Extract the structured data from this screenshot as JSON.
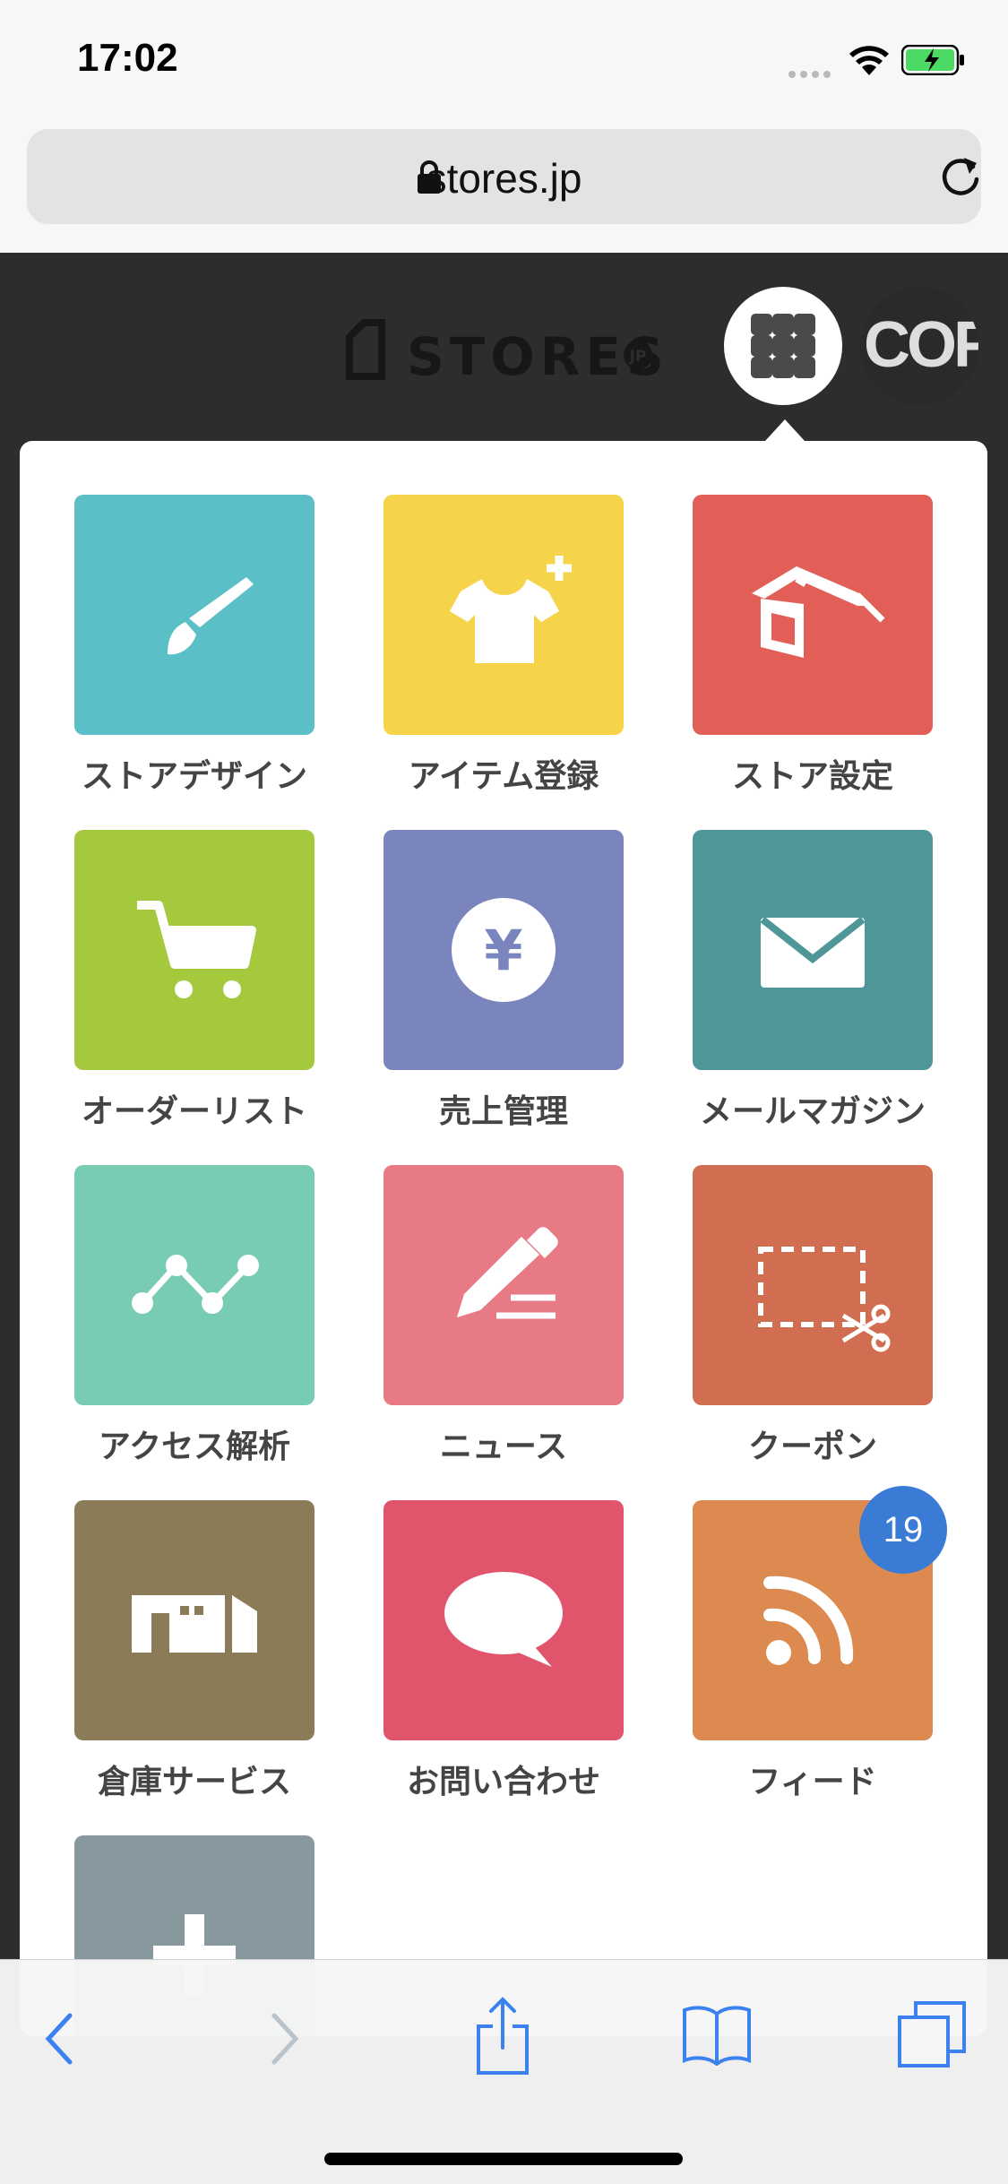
{
  "status_bar": {
    "time": "17:02"
  },
  "browser": {
    "url": "stores.jp"
  },
  "header": {
    "logo_text": "STORES",
    "logo_badge": "JP",
    "avatar_text": "COF"
  },
  "apps": [
    {
      "label": "ストアデザイン",
      "icon": "brush-icon",
      "color": "#5bbfc8"
    },
    {
      "label": "アイテム登録",
      "icon": "tshirt-plus-icon",
      "color": "#f6d44a"
    },
    {
      "label": "ストア設定",
      "icon": "house-icon",
      "color": "#e25f58"
    },
    {
      "label": "オーダーリスト",
      "icon": "cart-icon",
      "color": "#a4c93c"
    },
    {
      "label": "売上管理",
      "icon": "yen-icon",
      "color": "#7b85bd"
    },
    {
      "label": "メールマガジン",
      "icon": "envelope-icon",
      "color": "#4e9698"
    },
    {
      "label": "アクセス解析",
      "icon": "line-graph-icon",
      "color": "#78ccb3"
    },
    {
      "label": "ニュース",
      "icon": "pencil-icon",
      "color": "#e77a85"
    },
    {
      "label": "クーポン",
      "icon": "coupon-scissors-icon",
      "color": "#d16e51"
    },
    {
      "label": "倉庫サービス",
      "icon": "warehouse-icon",
      "color": "#8b7b57"
    },
    {
      "label": "お問い合わせ",
      "icon": "speech-bubble-icon",
      "color": "#e0556c"
    },
    {
      "label": "フィード",
      "icon": "rss-icon",
      "color": "#dc8a4f",
      "badge": "19"
    },
    {
      "label": "",
      "icon": "plus-icon",
      "color": "#87999f"
    }
  ]
}
